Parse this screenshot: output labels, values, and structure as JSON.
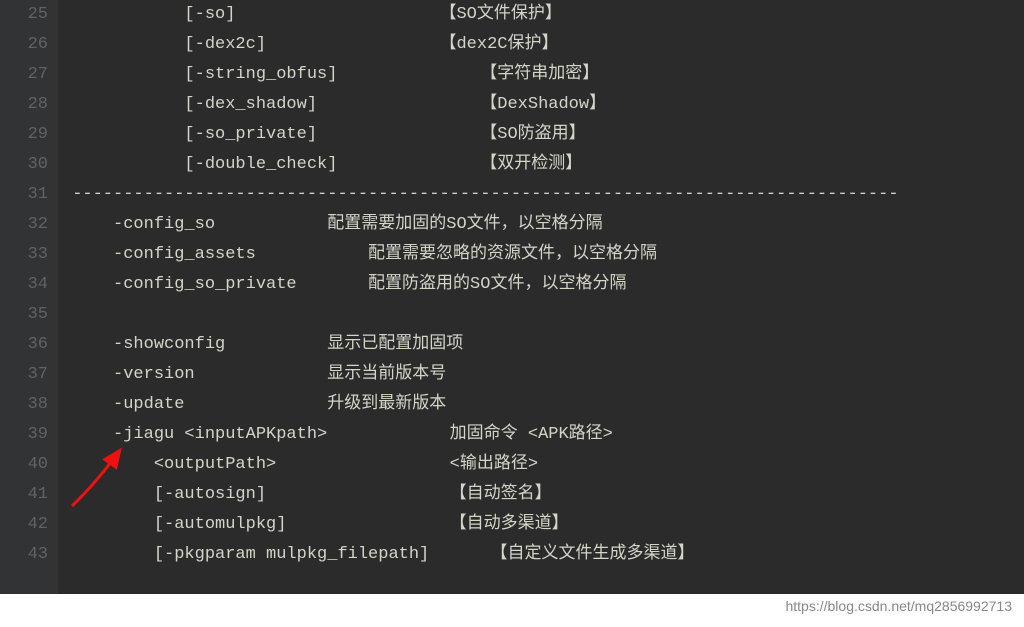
{
  "gutter": {
    "start": 25,
    "end": 43
  },
  "lines": [
    "            [-so]                    【SO文件保护】",
    "            [-dex2c]                 【dex2C保护】",
    "            [-string_obfus]              【字符串加密】",
    "            [-dex_shadow]                【DexShadow】",
    "            [-so_private]                【SO防盗用】",
    "            [-double_check]              【双开检测】",
    " ---------------------------------------------------------------------------------",
    "     -config_so           配置需要加固的SO文件，以空格分隔",
    "     -config_assets           配置需要忽略的资源文件，以空格分隔",
    "     -config_so_private       配置防盗用的SO文件，以空格分隔",
    "",
    "     -showconfig          显示已配置加固项",
    "     -version             显示当前版本号",
    "     -update              升级到最新版本",
    "     -jiagu <inputAPKpath>            加固命令 <APK路径>",
    "         <outputPath>                 <输出路径>",
    "         [-autosign]                  【自动签名】",
    "         [-automulpkg]                【自动多渠道】",
    "         [-pkgparam mulpkg_filepath]      【自定义文件生成多渠道】"
  ],
  "watermark": "https://blog.csdn.net/mq2856992713"
}
